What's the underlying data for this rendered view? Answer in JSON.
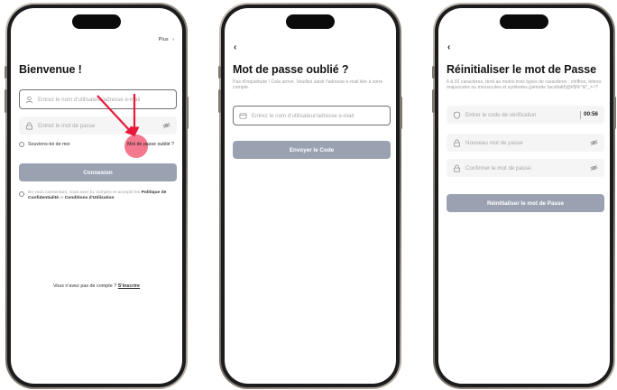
{
  "login": {
    "more_label": "Plus",
    "more_chevron": "›",
    "title": "Bienvenue !",
    "username_placeholder": "Entrez le nom d'utilisateur/adresse e-mail",
    "password_placeholder": "Entrez le mot de passe",
    "remember_label": "Souviens-toi de moi",
    "forgot_link": "Mot de passe oublié ?",
    "login_button": "Connexion",
    "terms_prefix": "En vous connectant, vous avez lu, compris et accepté les ",
    "privacy_policy": "Politique de Confidentialité",
    "terms_mid": " et ",
    "terms_conditions": "Conditions d'Utilisation",
    "no_account": "Vous n'avez pas de compte ? ",
    "signup_link": "S'inscrire"
  },
  "forgot": {
    "back": "‹",
    "title": "Mot de passe oublié ?",
    "subtitle": "Pas d'inquiétude ! Cela arrive. Veuillez saisir l'adresse e-mail liée à votre compte.",
    "email_placeholder": "Entrez le nom d'utilisateur/adresse e-mail",
    "send_button": "Envoyer le Code"
  },
  "reset": {
    "back": "‹",
    "title": "Réinitialiser le mot de Passe",
    "subtitle": "6 à 32 caractères, dont au moins trois types de caractères : chiffres, lettres majuscules ou minuscules et symboles,(période facultatif)@#$%^&*_=-!?",
    "code_placeholder": "Entrer le code de vérification",
    "timer": "00:56",
    "new_password_placeholder": "Nouveau mot de passe",
    "confirm_password_placeholder": "Confirmer le mot de passe",
    "reset_button": "Réinitialiser le mot de Passe"
  },
  "colors": {
    "primary_button": "#9aa2b2",
    "annotation_arrow": "#e8173b",
    "tap_indicator": "#f2627a"
  }
}
